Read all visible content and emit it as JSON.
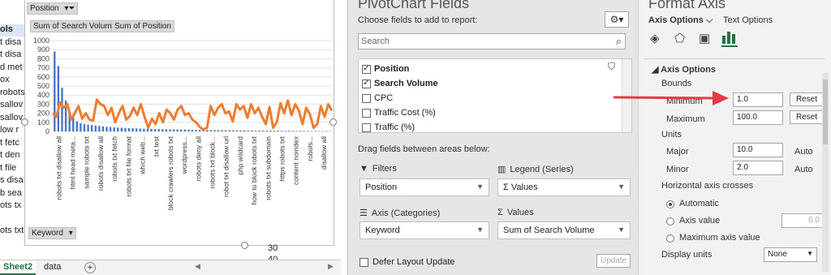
{
  "sheet": {
    "row_labels": [
      "ols",
      "t disa",
      "t disa",
      "d met",
      "ox",
      "robots",
      "sallov",
      "sallov",
      "low r",
      "t fetc",
      "t den",
      "t file",
      "s disa",
      "b sea",
      "ots tx",
      "",
      "ots txt"
    ],
    "right_numbers": [
      "30",
      "40"
    ],
    "position_field": "Position",
    "values_fields": [
      "Sum of Search Volume",
      "Sum of Position"
    ],
    "keyword_field": "Keyword",
    "tabs": [
      "Sheet2",
      "data"
    ],
    "add_sheet": "+",
    "prev_arrow": "◀",
    "next_arrow": "▶"
  },
  "chart_data": {
    "type": "bar+line",
    "y_ticks": [
      "1000",
      "900",
      "800",
      "700",
      "600",
      "500",
      "400",
      "300",
      "200",
      "100",
      "0"
    ],
    "ylim": [
      0,
      1000
    ],
    "categories": [
      "robots txt disallow all",
      "html head meta...",
      "sample robots txt",
      "robots disallow all",
      "robots txt fetch",
      "robots txt file format",
      "which web...",
      "txt test",
      "block crawlers robots txt",
      "wordpress...",
      "robots deny all",
      "robots txt block...",
      "robot txt disallow url",
      "php wildcard",
      "how to block robots txt",
      "robots txt subdomain",
      "https robots txt",
      "content noindex",
      "robots...",
      "disallow all"
    ],
    "bar_values": [
      880,
      720,
      480,
      340,
      200,
      170,
      110,
      90,
      80,
      75,
      70,
      65,
      60,
      55,
      50,
      48,
      45,
      42,
      40,
      38,
      36,
      35,
      33,
      32,
      30,
      30,
      28,
      27,
      26,
      25,
      24,
      23,
      22,
      21,
      20,
      20,
      19,
      18,
      18,
      17,
      16,
      16,
      15,
      15,
      14,
      14,
      13,
      13,
      12,
      12,
      11,
      11,
      10,
      10,
      10,
      9,
      9,
      9,
      8,
      8,
      8,
      7,
      7,
      7,
      6,
      6,
      6,
      5,
      5,
      5,
      5,
      4,
      4,
      4,
      3
    ],
    "line_values": [
      200,
      160,
      320,
      260,
      300,
      130,
      200,
      280,
      140,
      200,
      130,
      120,
      350,
      300,
      280,
      180,
      260,
      100,
      200,
      280,
      130,
      170,
      260,
      180,
      300,
      160,
      40,
      140,
      80,
      200,
      100,
      240,
      200,
      130,
      240,
      280,
      180,
      200,
      130,
      100,
      50,
      20,
      40,
      280,
      180,
      260,
      300,
      200,
      220,
      110,
      300,
      240,
      280,
      150,
      300,
      200,
      260,
      160,
      80,
      270,
      40,
      100,
      310,
      200,
      340,
      180,
      300,
      230,
      80,
      260,
      190,
      40,
      80,
      280,
      160,
      300,
      230
    ],
    "bar_color": "#4472c4",
    "line_color": "#ed7d31"
  },
  "pivot": {
    "title": "PivotChart Fields",
    "choose_label": "Choose fields to add to report:",
    "search_placeholder": "Search",
    "fields": [
      {
        "label": "Position",
        "checked": true,
        "bold": true
      },
      {
        "label": "Search Volume",
        "checked": true,
        "bold": true
      },
      {
        "label": "CPC",
        "checked": false,
        "bold": false
      },
      {
        "label": "Traffic Cost (%)",
        "checked": false,
        "bold": false
      },
      {
        "label": "Traffic (%)",
        "checked": false,
        "bold": false
      }
    ],
    "drag_label": "Drag fields between areas below:",
    "filters_label": "Filters",
    "filters_value": "Position",
    "legend_label": "Legend (Series)",
    "legend_value": "Σ Values",
    "axis_label": "Axis (Categories)",
    "axis_value": "Keyword",
    "values_label": "Values",
    "values_value": "Sum of Search Volume",
    "defer_label": "Defer Layout Update",
    "update_label": "Update"
  },
  "format": {
    "title": "Format Axis",
    "tab_axis": "Axis Options",
    "tab_text": "Text Options",
    "section": "Axis Options",
    "bounds": "Bounds",
    "minimum_label": "Minimum",
    "minimum_value": "1.0",
    "maximum_label": "Maximum",
    "maximum_value": "100.0",
    "reset": "Reset",
    "units": "Units",
    "major_label": "Major",
    "major_value": "10.0",
    "minor_label": "Minor",
    "minor_value": "2.0",
    "auto": "Auto",
    "hcross": "Horizontal axis crosses",
    "opt_auto": "Automatic",
    "opt_value": "Axis value",
    "axis_value_box": "0.0",
    "opt_max": "Maximum axis value",
    "display_units": "Display units",
    "display_units_value": "None",
    "arrow_color": "#e63946"
  }
}
